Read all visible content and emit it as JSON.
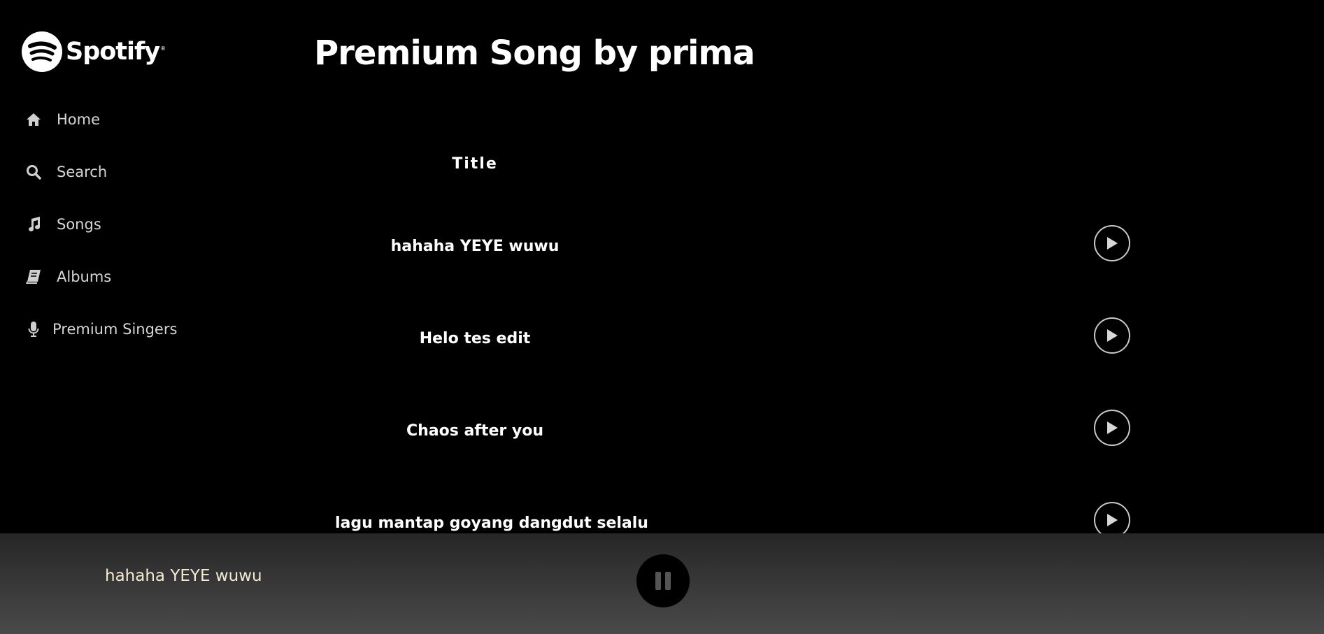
{
  "brand": {
    "name": "Spotify",
    "trademark": "®"
  },
  "sidebar": {
    "items": [
      {
        "label": "Home",
        "icon": "home-icon"
      },
      {
        "label": "Search",
        "icon": "search-icon"
      },
      {
        "label": "Songs",
        "icon": "music-note-icon"
      },
      {
        "label": "Albums",
        "icon": "book-icon"
      },
      {
        "label": "Premium Singers",
        "icon": "microphone-icon"
      }
    ]
  },
  "main": {
    "title": "Premium Song by prima",
    "column_header": "Title",
    "songs": [
      {
        "title": "hahaha YEYE wuwu"
      },
      {
        "title": "Helo tes edit"
      },
      {
        "title": "Chaos after you"
      },
      {
        "title": "lagu mantap goyang dangdut selalu"
      }
    ]
  },
  "player": {
    "now_playing": "hahaha YEYE wuwu",
    "state": "playing"
  },
  "colors": {
    "background": "#000000",
    "nav_text": "#d6d6d6",
    "now_playing_text": "#f3ead2"
  }
}
